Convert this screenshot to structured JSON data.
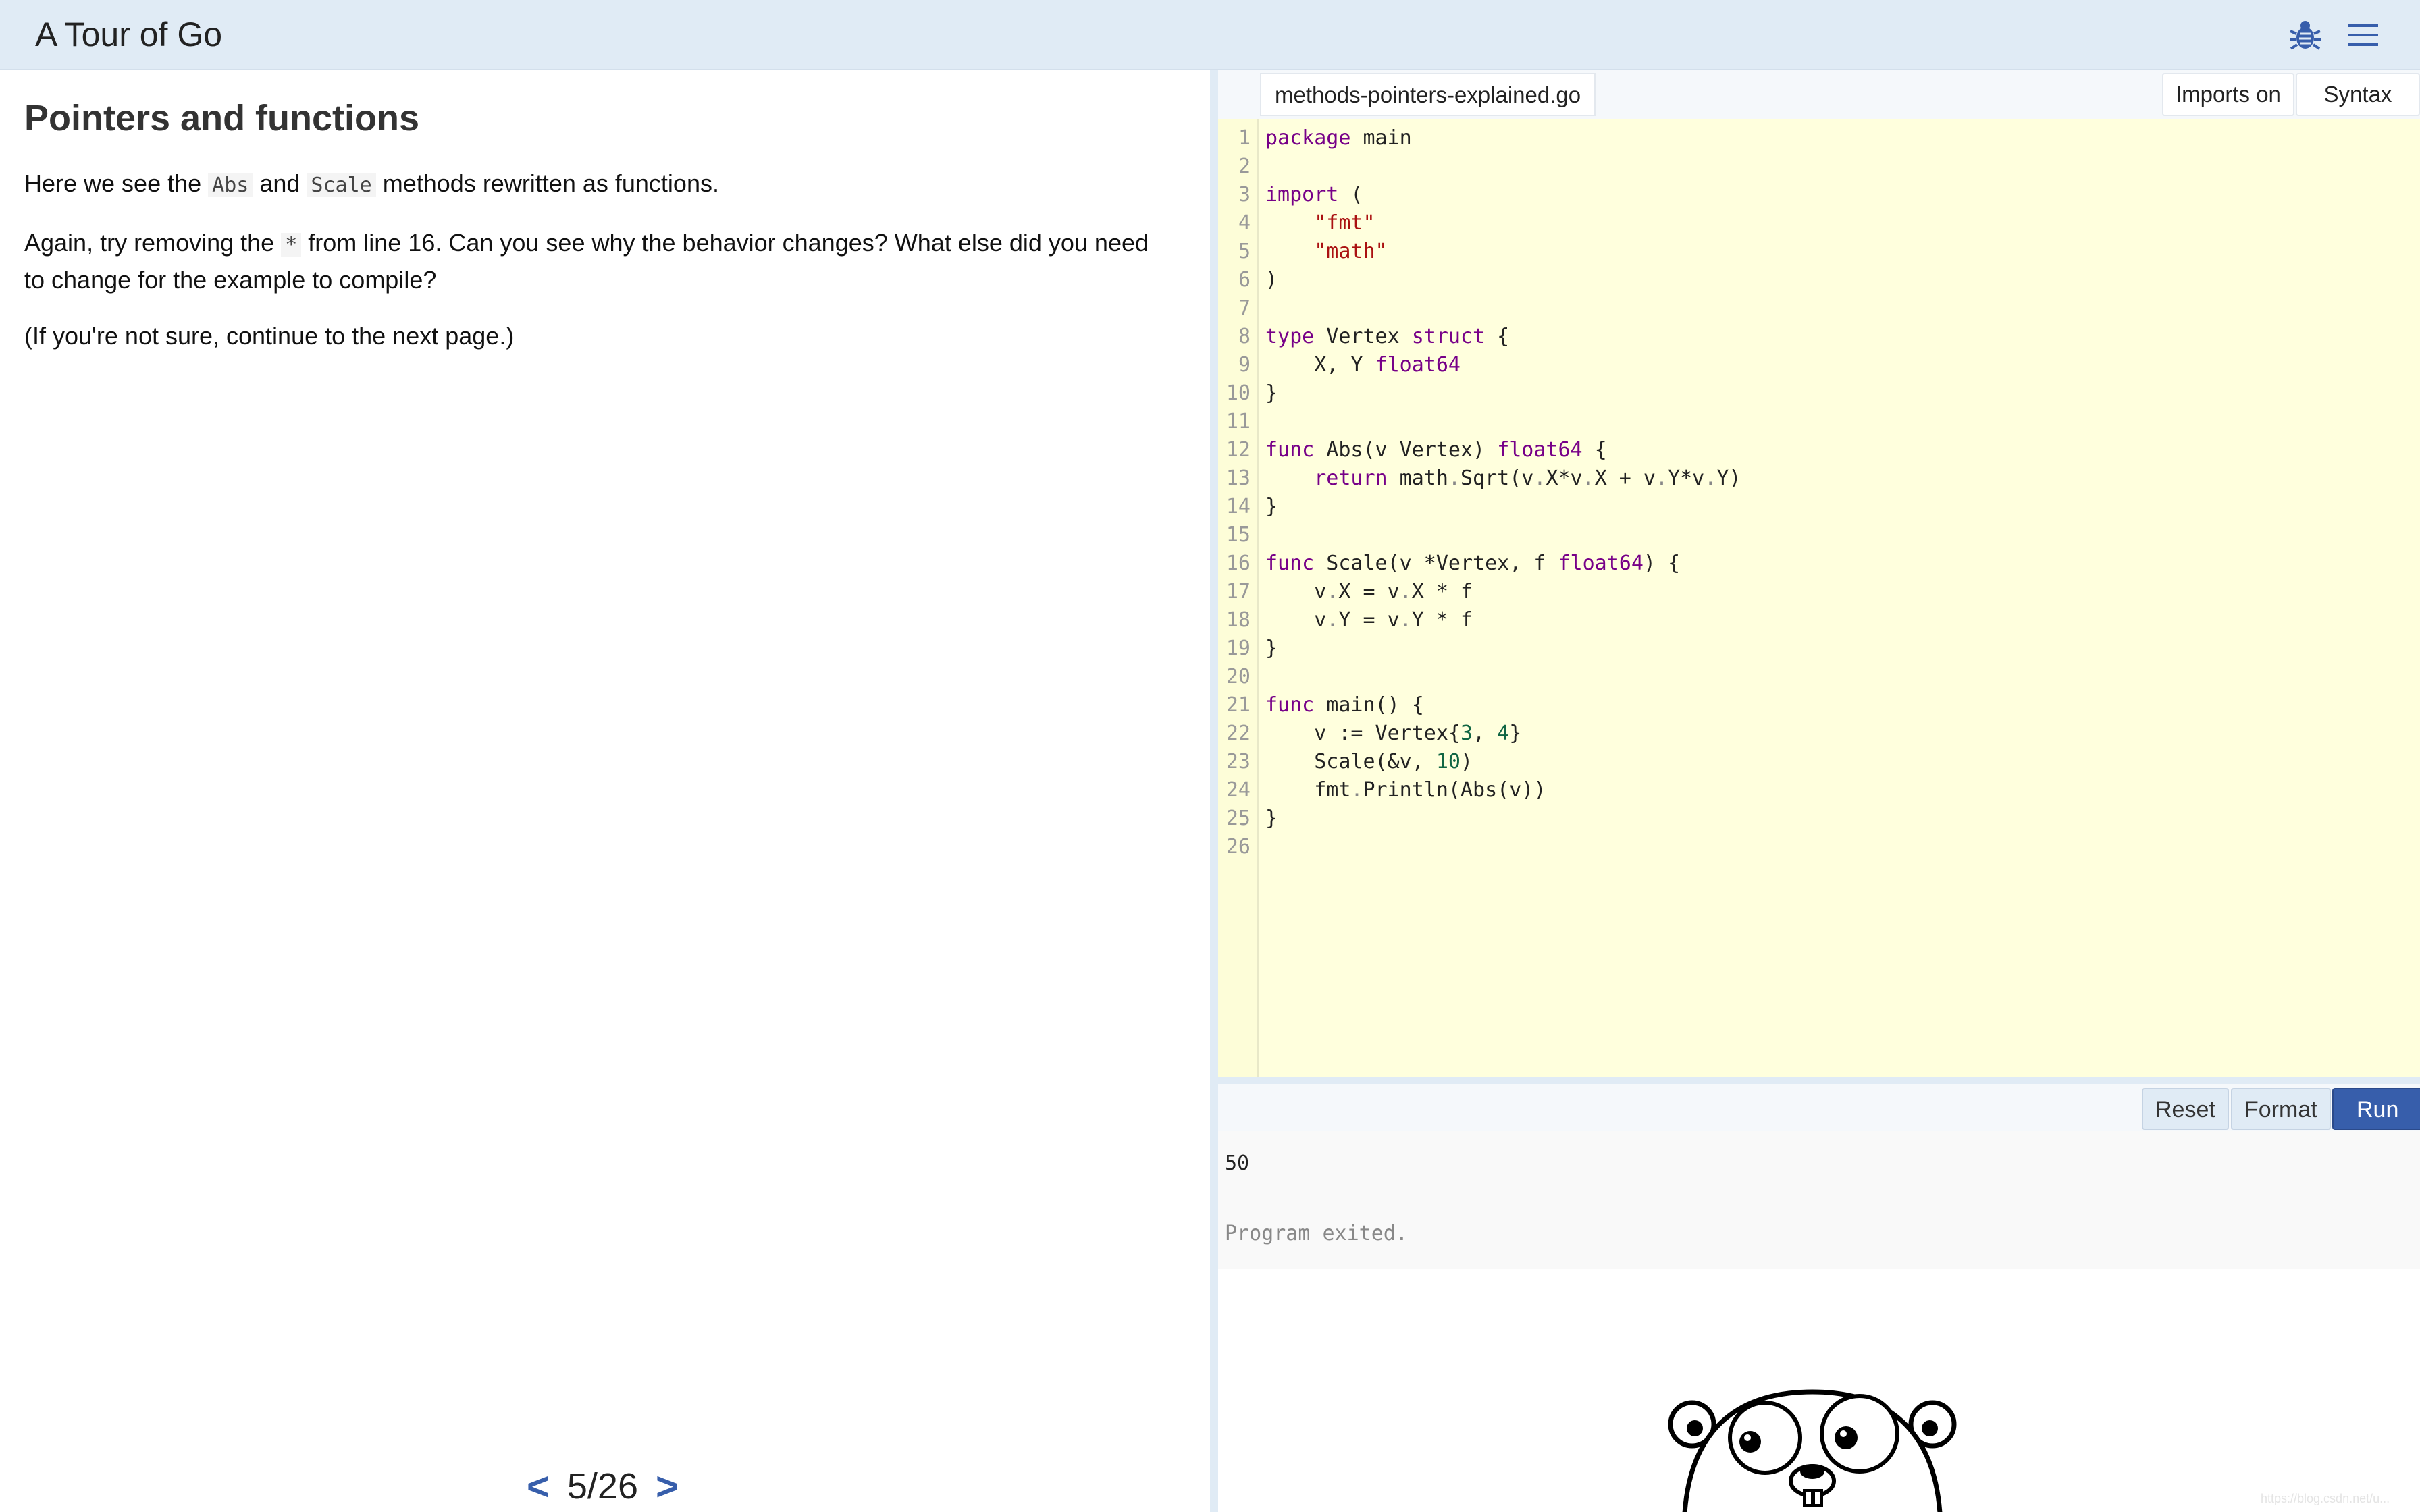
{
  "header": {
    "title": "A Tour of Go",
    "icons": [
      "bug-icon",
      "hamburger-menu-icon"
    ]
  },
  "lesson": {
    "title": "Pointers and functions",
    "p1": {
      "before": "Here we see the ",
      "code1": "Abs",
      "mid": " and ",
      "code2": "Scale",
      "after": " methods rewritten as functions."
    },
    "p2": {
      "before": "Again, try removing the ",
      "code": "*",
      "after": " from line 16. Can you see why the behavior changes? What else did you need to change for the example to compile?"
    },
    "p3": "(If you're not sure, continue to the next page.)",
    "pager": {
      "prev": "<",
      "count": "5/26",
      "next": ">"
    }
  },
  "editor": {
    "file_tab": "methods-pointers-explained.go",
    "imports_toggle": "Imports on",
    "syntax_toggle": "Syntax on",
    "lines": [
      [
        [
          "kw",
          "package"
        ],
        [
          "t",
          " main"
        ]
      ],
      [],
      [
        [
          "kw",
          "import"
        ],
        [
          "t",
          " ("
        ]
      ],
      [
        [
          "t",
          "    "
        ],
        [
          "str",
          "\"fmt\""
        ]
      ],
      [
        [
          "t",
          "    "
        ],
        [
          "str",
          "\"math\""
        ]
      ],
      [
        [
          "t",
          ")"
        ]
      ],
      [],
      [
        [
          "kw",
          "type"
        ],
        [
          "t",
          " Vertex "
        ],
        [
          "kw",
          "struct"
        ],
        [
          "t",
          " {"
        ]
      ],
      [
        [
          "t",
          "    X, Y "
        ],
        [
          "kw",
          "float64"
        ]
      ],
      [
        [
          "t",
          "}"
        ]
      ],
      [],
      [
        [
          "kw",
          "func"
        ],
        [
          "t",
          " Abs(v Vertex) "
        ],
        [
          "kw",
          "float64"
        ],
        [
          "t",
          " {"
        ]
      ],
      [
        [
          "t",
          "    "
        ],
        [
          "kw",
          "return"
        ],
        [
          "t",
          " math"
        ],
        [
          "op",
          "."
        ],
        [
          "t",
          "Sqrt(v"
        ],
        [
          "op",
          "."
        ],
        [
          "t",
          "X*v"
        ],
        [
          "op",
          "."
        ],
        [
          "t",
          "X + v"
        ],
        [
          "op",
          "."
        ],
        [
          "t",
          "Y*v"
        ],
        [
          "op",
          "."
        ],
        [
          "t",
          "Y)"
        ]
      ],
      [
        [
          "t",
          "}"
        ]
      ],
      [],
      [
        [
          "kw",
          "func"
        ],
        [
          "t",
          " Scale(v *Vertex, f "
        ],
        [
          "kw",
          "float64"
        ],
        [
          "t",
          ") {"
        ]
      ],
      [
        [
          "t",
          "    v"
        ],
        [
          "op",
          "."
        ],
        [
          "t",
          "X = v"
        ],
        [
          "op",
          "."
        ],
        [
          "t",
          "X * f"
        ]
      ],
      [
        [
          "t",
          "    v"
        ],
        [
          "op",
          "."
        ],
        [
          "t",
          "Y = v"
        ],
        [
          "op",
          "."
        ],
        [
          "t",
          "Y * f"
        ]
      ],
      [
        [
          "t",
          "}"
        ]
      ],
      [],
      [
        [
          "kw",
          "func"
        ],
        [
          "t",
          " main() {"
        ]
      ],
      [
        [
          "t",
          "    v := Vertex{"
        ],
        [
          "num",
          "3"
        ],
        [
          "t",
          ", "
        ],
        [
          "num",
          "4"
        ],
        [
          "t",
          "}"
        ]
      ],
      [
        [
          "t",
          "    Scale(&v, "
        ],
        [
          "num",
          "10"
        ],
        [
          "t",
          ")"
        ]
      ],
      [
        [
          "t",
          "    fmt"
        ],
        [
          "op",
          "."
        ],
        [
          "t",
          "Println(Abs(v))"
        ]
      ],
      [
        [
          "t",
          "}"
        ]
      ],
      []
    ],
    "buttons": {
      "reset": "Reset",
      "format": "Format",
      "run": "Run"
    },
    "output": {
      "result": "50",
      "status": "Program exited."
    }
  },
  "colors": {
    "topbar": "#e0ebf5",
    "code_bg": "#ffffdd",
    "keyword": "#770088",
    "string": "#aa1111",
    "number": "#116644",
    "run_button": "#375eab"
  },
  "watermark": "https://blog.csdn.net/u..."
}
